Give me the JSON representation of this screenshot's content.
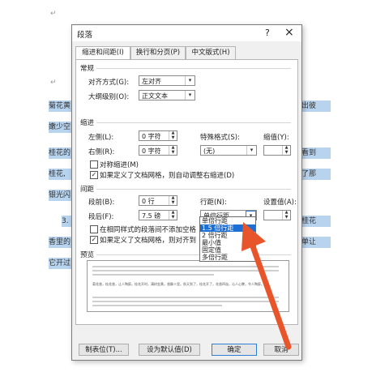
{
  "document": {
    "para_mark": "↵",
    "bg_fragments_left": [
      "菊花黄",
      "嫩少空",
      "桂花的",
      "桂花,",
      "银光闪",
      "3.",
      "香里的",
      "它开过"
    ],
    "bg_fragments_right": [
      "出彼",
      "看到",
      "了那",
      "桂花",
      "单让"
    ]
  },
  "dialog": {
    "title": "段落",
    "help_label": "?",
    "close_label": "×",
    "tabs": [
      "缩进和间距(I)",
      "换行和分页(P)",
      "中文版式(H)"
    ],
    "general": {
      "section": "常规",
      "alignment_label": "对齐方式(G):",
      "alignment_value": "左对齐",
      "outline_label": "大纲级别(O):",
      "outline_value": "正文文本"
    },
    "indent": {
      "section": "缩进",
      "left_label": "左侧(L):",
      "left_value": "0 字符",
      "right_label": "右侧(R):",
      "right_value": "0 字符",
      "special_label": "特殊格式(S):",
      "special_value": "(无)",
      "by_label": "缩值(Y):",
      "by_value": "",
      "mirror_label": "对称缩进(M)",
      "grid_label": "如果定义了文档网格，则自动调整右缩进(D)"
    },
    "spacing": {
      "section": "间距",
      "before_label": "段前(B):",
      "before_value": "0 行",
      "after_label": "段后(F):",
      "after_value": "7.5 磅",
      "line_label": "行距(N):",
      "line_value": "单倍行距",
      "at_label": "设置值(A):",
      "at_value": "",
      "nospace_label": "在相同样式的段落间不添加空格",
      "snap_label": "如果定义了文档网格，则对齐到"
    },
    "line_spacing_options": [
      "单倍行距",
      "1.5 倍行距",
      "2 倍行距",
      "最小值",
      "固定值",
      "多倍行距"
    ],
    "selected_option_index": 1,
    "preview": {
      "section": "预览",
      "sample_text": "菊花香，桂花香，让人陶醉。桂花开时，满树金黄，香飘十里。秋天到了，桂花开了，花香四溢，沁人心脾，令人陶醉。"
    },
    "buttons": {
      "tabs_label": "制表位(T)...",
      "default_label": "设为默认值(D)",
      "ok_label": "确定",
      "cancel_label": "取消"
    }
  },
  "colors": {
    "highlight": "#b7d3ee",
    "selection": "#1e6fd4",
    "arrow": "#e8552b"
  }
}
